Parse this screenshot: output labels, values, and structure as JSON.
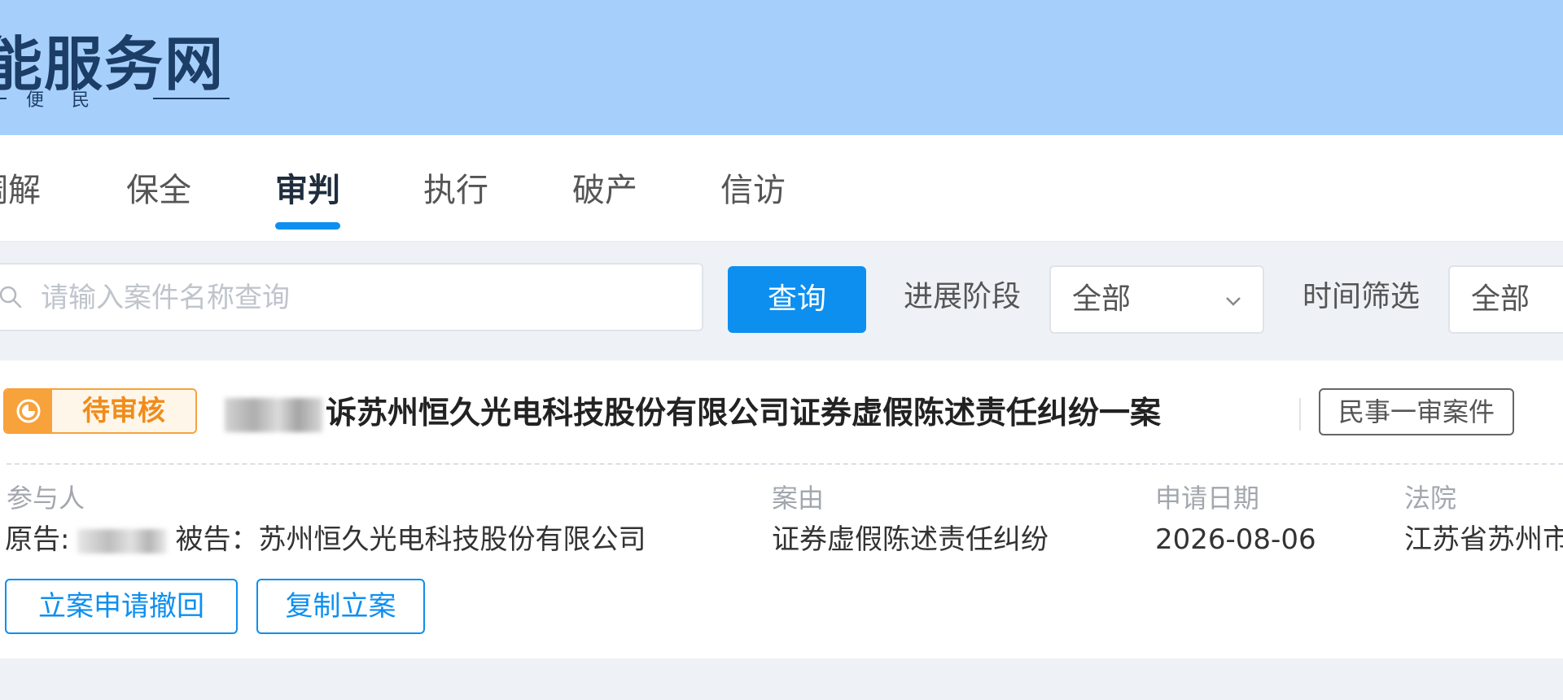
{
  "header": {
    "brand_fragment": "能服务网",
    "tagline_fragment": "便民",
    "bg_color": "#a6d0fb"
  },
  "tabs": [
    {
      "label": "调解",
      "active": false
    },
    {
      "label": "保全",
      "active": false
    },
    {
      "label": "审判",
      "active": true
    },
    {
      "label": "执行",
      "active": false
    },
    {
      "label": "破产",
      "active": false
    },
    {
      "label": "信访",
      "active": false
    }
  ],
  "search": {
    "placeholder": "请输入案件名称查询",
    "value": "",
    "icon": "search-icon",
    "button_label": "查询"
  },
  "filters": {
    "stage_label": "进展阶段",
    "stage_value": "全部",
    "time_label": "时间筛选",
    "time_value": "全部"
  },
  "case": {
    "status": "待审核",
    "status_color": "#f7a23a",
    "title_suffix": "诉苏州恒久光电科技股份有限公司证券虚假陈述责任纠纷一案",
    "type_tag": "民事一审案件",
    "participants_label": "参与人",
    "plaintiff_prefix": "原告:",
    "defendant_text": "被告：苏州恒久光电科技股份有限公司",
    "cause_label": "案由",
    "cause_value": "证券虚假陈述责任纠纷",
    "date_label": "申请日期",
    "date_value": "2026-08-06",
    "court_label": "法院",
    "court_value": "江苏省苏州市",
    "withdraw_button": "立案申请撤回",
    "copy_button": "复制立案"
  },
  "accent_color": "#0d8ff0"
}
